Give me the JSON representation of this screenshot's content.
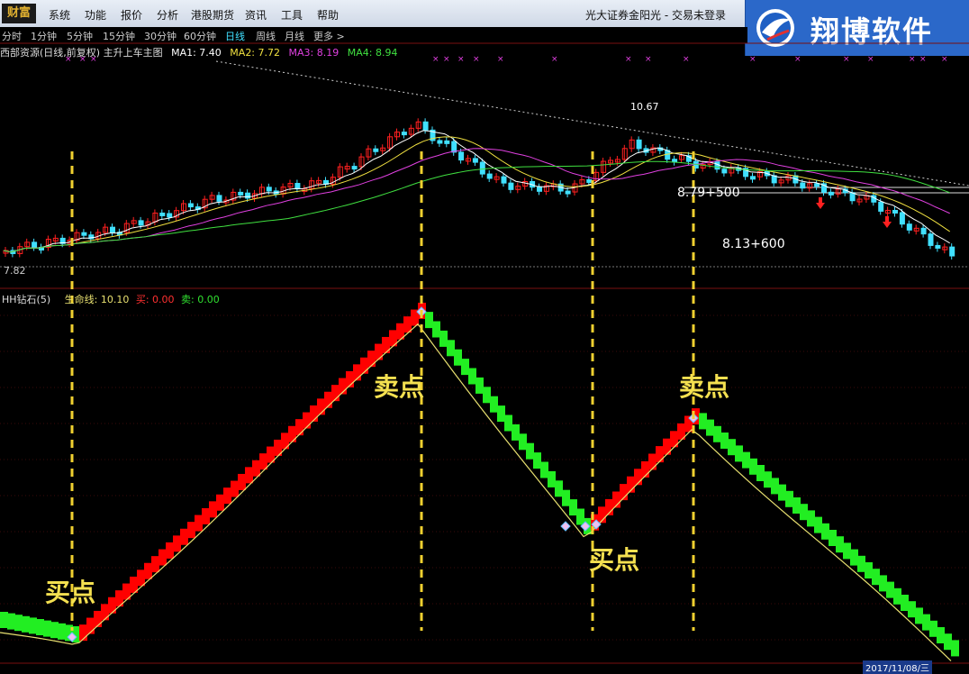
{
  "app": {
    "logo_text": "财富",
    "menu": [
      "系统",
      "功能",
      "报价",
      "分析",
      "港股期货",
      "资讯",
      "工具",
      "帮助"
    ],
    "broker": "光大证券金阳光 - 交易未登录"
  },
  "brand": {
    "name": "翔博软件"
  },
  "periods": [
    "分时",
    "1分钟",
    "5分钟",
    "15分钟",
    "30分钟",
    "60分钟",
    "日线",
    "周线",
    "月线",
    "更多 >"
  ],
  "active_period": "日线",
  "main_header": {
    "title": "西部资源(日线,前复权) 主升上车主图",
    "ma1": "MA1: 7.40",
    "ma2": "MA2: 7.72",
    "ma3": "MA3: 8.19",
    "ma4": "MA4: 8.94"
  },
  "price_labels": {
    "high": "10.67",
    "low": "7.82",
    "level1": "8.79+500",
    "level2": "8.13+600"
  },
  "indicator_header": {
    "name": "HH钻石(5)",
    "life": "生命线: 10.10",
    "buy": "买: 0.00",
    "sell": "卖: 0.00"
  },
  "annotations": {
    "buy": "买点",
    "sell": "卖点"
  },
  "date_label": "2017/11/08/三",
  "colors": {
    "up": "#ff2020",
    "down": "#40e0ff",
    "buy_bar": "#ff0000",
    "sell_bar": "#22ee22",
    "life": "#e8e070",
    "guide": "#f0d030"
  },
  "chart_data": {
    "type": "line",
    "series": [
      {
        "name": "生命线",
        "values": [
          10.1
        ]
      }
    ]
  }
}
